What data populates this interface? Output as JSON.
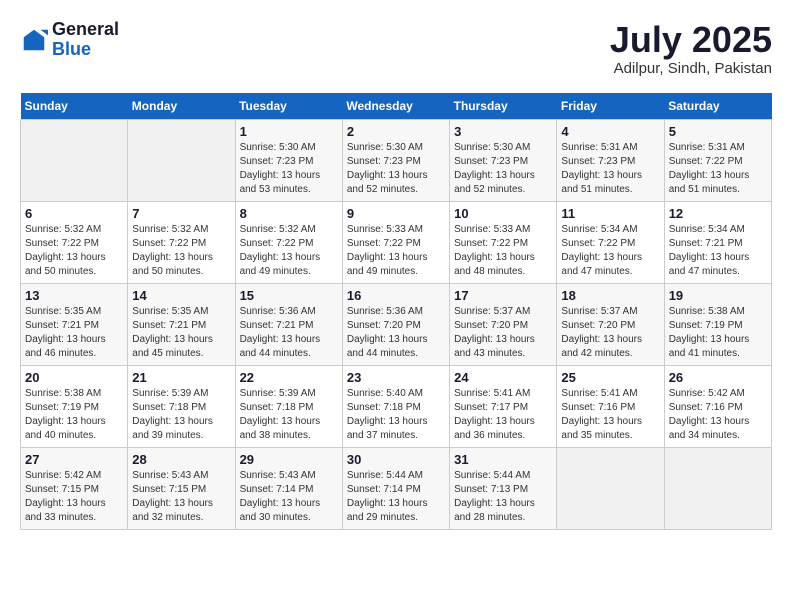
{
  "header": {
    "logo_general": "General",
    "logo_blue": "Blue",
    "month_year": "July 2025",
    "location": "Adilpur, Sindh, Pakistan"
  },
  "calendar": {
    "weekdays": [
      "Sunday",
      "Monday",
      "Tuesday",
      "Wednesday",
      "Thursday",
      "Friday",
      "Saturday"
    ],
    "weeks": [
      [
        {
          "day": "",
          "info": ""
        },
        {
          "day": "",
          "info": ""
        },
        {
          "day": "1",
          "info": "Sunrise: 5:30 AM\nSunset: 7:23 PM\nDaylight: 13 hours\nand 53 minutes."
        },
        {
          "day": "2",
          "info": "Sunrise: 5:30 AM\nSunset: 7:23 PM\nDaylight: 13 hours\nand 52 minutes."
        },
        {
          "day": "3",
          "info": "Sunrise: 5:30 AM\nSunset: 7:23 PM\nDaylight: 13 hours\nand 52 minutes."
        },
        {
          "day": "4",
          "info": "Sunrise: 5:31 AM\nSunset: 7:23 PM\nDaylight: 13 hours\nand 51 minutes."
        },
        {
          "day": "5",
          "info": "Sunrise: 5:31 AM\nSunset: 7:22 PM\nDaylight: 13 hours\nand 51 minutes."
        }
      ],
      [
        {
          "day": "6",
          "info": "Sunrise: 5:32 AM\nSunset: 7:22 PM\nDaylight: 13 hours\nand 50 minutes."
        },
        {
          "day": "7",
          "info": "Sunrise: 5:32 AM\nSunset: 7:22 PM\nDaylight: 13 hours\nand 50 minutes."
        },
        {
          "day": "8",
          "info": "Sunrise: 5:32 AM\nSunset: 7:22 PM\nDaylight: 13 hours\nand 49 minutes."
        },
        {
          "day": "9",
          "info": "Sunrise: 5:33 AM\nSunset: 7:22 PM\nDaylight: 13 hours\nand 49 minutes."
        },
        {
          "day": "10",
          "info": "Sunrise: 5:33 AM\nSunset: 7:22 PM\nDaylight: 13 hours\nand 48 minutes."
        },
        {
          "day": "11",
          "info": "Sunrise: 5:34 AM\nSunset: 7:22 PM\nDaylight: 13 hours\nand 47 minutes."
        },
        {
          "day": "12",
          "info": "Sunrise: 5:34 AM\nSunset: 7:21 PM\nDaylight: 13 hours\nand 47 minutes."
        }
      ],
      [
        {
          "day": "13",
          "info": "Sunrise: 5:35 AM\nSunset: 7:21 PM\nDaylight: 13 hours\nand 46 minutes."
        },
        {
          "day": "14",
          "info": "Sunrise: 5:35 AM\nSunset: 7:21 PM\nDaylight: 13 hours\nand 45 minutes."
        },
        {
          "day": "15",
          "info": "Sunrise: 5:36 AM\nSunset: 7:21 PM\nDaylight: 13 hours\nand 44 minutes."
        },
        {
          "day": "16",
          "info": "Sunrise: 5:36 AM\nSunset: 7:20 PM\nDaylight: 13 hours\nand 44 minutes."
        },
        {
          "day": "17",
          "info": "Sunrise: 5:37 AM\nSunset: 7:20 PM\nDaylight: 13 hours\nand 43 minutes."
        },
        {
          "day": "18",
          "info": "Sunrise: 5:37 AM\nSunset: 7:20 PM\nDaylight: 13 hours\nand 42 minutes."
        },
        {
          "day": "19",
          "info": "Sunrise: 5:38 AM\nSunset: 7:19 PM\nDaylight: 13 hours\nand 41 minutes."
        }
      ],
      [
        {
          "day": "20",
          "info": "Sunrise: 5:38 AM\nSunset: 7:19 PM\nDaylight: 13 hours\nand 40 minutes."
        },
        {
          "day": "21",
          "info": "Sunrise: 5:39 AM\nSunset: 7:18 PM\nDaylight: 13 hours\nand 39 minutes."
        },
        {
          "day": "22",
          "info": "Sunrise: 5:39 AM\nSunset: 7:18 PM\nDaylight: 13 hours\nand 38 minutes."
        },
        {
          "day": "23",
          "info": "Sunrise: 5:40 AM\nSunset: 7:18 PM\nDaylight: 13 hours\nand 37 minutes."
        },
        {
          "day": "24",
          "info": "Sunrise: 5:41 AM\nSunset: 7:17 PM\nDaylight: 13 hours\nand 36 minutes."
        },
        {
          "day": "25",
          "info": "Sunrise: 5:41 AM\nSunset: 7:16 PM\nDaylight: 13 hours\nand 35 minutes."
        },
        {
          "day": "26",
          "info": "Sunrise: 5:42 AM\nSunset: 7:16 PM\nDaylight: 13 hours\nand 34 minutes."
        }
      ],
      [
        {
          "day": "27",
          "info": "Sunrise: 5:42 AM\nSunset: 7:15 PM\nDaylight: 13 hours\nand 33 minutes."
        },
        {
          "day": "28",
          "info": "Sunrise: 5:43 AM\nSunset: 7:15 PM\nDaylight: 13 hours\nand 32 minutes."
        },
        {
          "day": "29",
          "info": "Sunrise: 5:43 AM\nSunset: 7:14 PM\nDaylight: 13 hours\nand 30 minutes."
        },
        {
          "day": "30",
          "info": "Sunrise: 5:44 AM\nSunset: 7:14 PM\nDaylight: 13 hours\nand 29 minutes."
        },
        {
          "day": "31",
          "info": "Sunrise: 5:44 AM\nSunset: 7:13 PM\nDaylight: 13 hours\nand 28 minutes."
        },
        {
          "day": "",
          "info": ""
        },
        {
          "day": "",
          "info": ""
        }
      ]
    ]
  }
}
